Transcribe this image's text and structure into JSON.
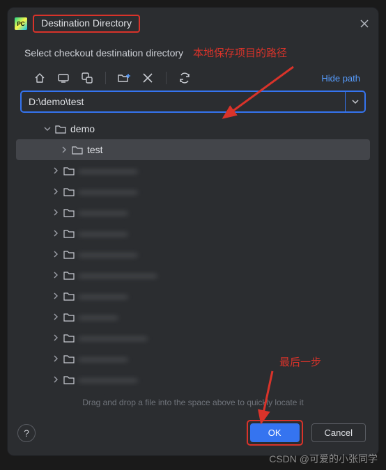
{
  "dialog": {
    "app_icon_label": "PC",
    "title": "Destination Directory",
    "subtitle": "Select checkout destination directory",
    "hide_path": "Hide path",
    "path_value": "D:\\demo\\test",
    "hint": "Drag and drop a file into the space above to quickly locate it"
  },
  "annotations": {
    "path_note": "本地保存项目的路径",
    "ok_note": "最后一步"
  },
  "toolbar": {
    "home": "home-icon",
    "desktop": "desktop-icon",
    "module": "module-icon",
    "new_folder": "new-folder-icon",
    "delete": "delete-icon",
    "refresh": "refresh-icon"
  },
  "tree": {
    "items": [
      {
        "label": "demo",
        "expanded": true,
        "level": 0,
        "selected": false,
        "blurred": false
      },
      {
        "label": "test",
        "expanded": false,
        "level": 1,
        "selected": true,
        "blurred": false
      },
      {
        "label": "——————",
        "expanded": false,
        "level": "b",
        "selected": false,
        "blurred": true
      },
      {
        "label": "——————",
        "expanded": false,
        "level": "b",
        "selected": false,
        "blurred": true
      },
      {
        "label": "—————",
        "expanded": false,
        "level": "b",
        "selected": false,
        "blurred": true
      },
      {
        "label": "—————",
        "expanded": false,
        "level": "b",
        "selected": false,
        "blurred": true
      },
      {
        "label": "——————",
        "expanded": false,
        "level": "b",
        "selected": false,
        "blurred": true
      },
      {
        "label": "————————",
        "expanded": false,
        "level": "b",
        "selected": false,
        "blurred": true
      },
      {
        "label": "—————",
        "expanded": false,
        "level": "b",
        "selected": false,
        "blurred": true
      },
      {
        "label": "————",
        "expanded": false,
        "level": "b",
        "selected": false,
        "blurred": true
      },
      {
        "label": "———————",
        "expanded": false,
        "level": "b",
        "selected": false,
        "blurred": true
      },
      {
        "label": "—————",
        "expanded": false,
        "level": "b",
        "selected": false,
        "blurred": true
      },
      {
        "label": "——————",
        "expanded": false,
        "level": "b",
        "selected": false,
        "blurred": true
      },
      {
        "label": "———",
        "expanded": false,
        "level": "b",
        "selected": false,
        "blurred": true
      }
    ]
  },
  "footer": {
    "ok": "OK",
    "cancel": "Cancel",
    "help": "?"
  },
  "watermark": "CSDN @可爱的小张同学"
}
